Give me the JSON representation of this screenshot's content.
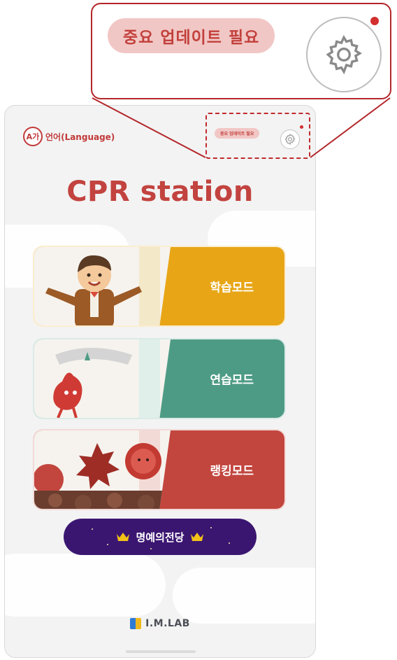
{
  "callout": {
    "update_label": "중요 업데이트 필요",
    "icon": "gear-icon"
  },
  "header": {
    "language_icon_text": "A가",
    "language_label": "언어(Language)",
    "update_label_small": "중요 업데이트 필요",
    "settings_icon": "gear-icon"
  },
  "app": {
    "title": "CPR station"
  },
  "modes": [
    {
      "label": "학습모드",
      "color": "#e8a617"
    },
    {
      "label": "연습모드",
      "color": "#4e9b85"
    },
    {
      "label": "랭킹모드",
      "color": "#c2463e"
    }
  ],
  "hall_of_fame": {
    "label": "명예의전당",
    "icon": "crown-icon",
    "color": "#3b1671"
  },
  "footer": {
    "brand": "I.M.LAB"
  },
  "colors": {
    "accent_red": "#c2433f",
    "callout_border": "#b3262a"
  }
}
